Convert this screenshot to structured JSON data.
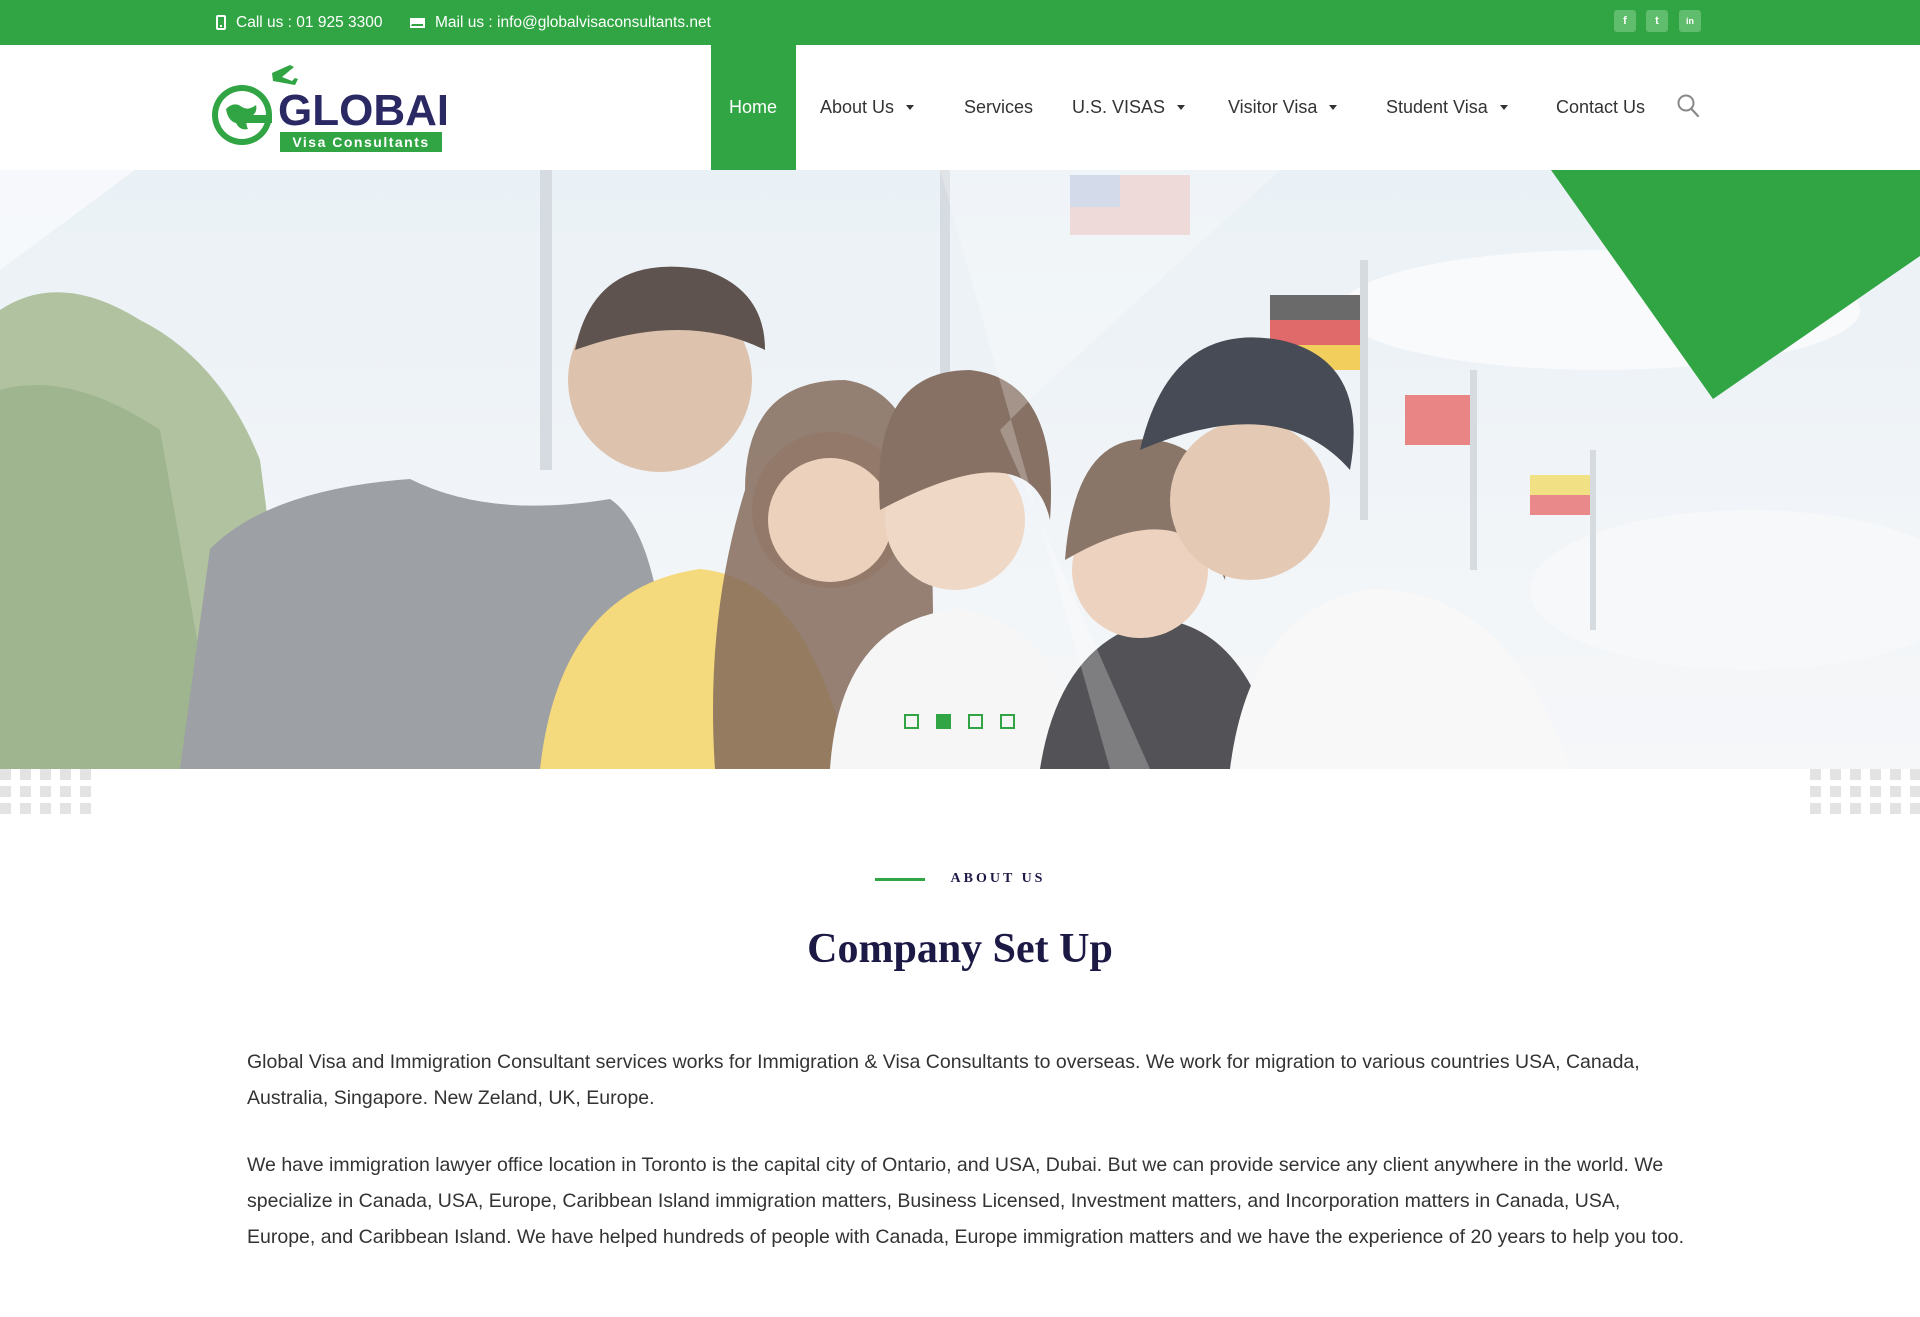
{
  "topbar": {
    "phone_text": "Call us : 01 925 3300",
    "mail_text": "Mail us : info@globalvisaconsultants.net",
    "social": [
      {
        "name": "facebook-icon",
        "glyph": "f"
      },
      {
        "name": "twitter-icon",
        "glyph": "t"
      },
      {
        "name": "linkedin-icon",
        "glyph": "in"
      }
    ]
  },
  "logo": {
    "word": "GLOBAL",
    "tagline": "Visa Consultants"
  },
  "nav": {
    "home": "Home",
    "about": "About Us",
    "services": "Services",
    "usvisas": "U.S. VISAS",
    "visitor": "Visitor Visa",
    "student": "Student Visa",
    "contact": "Contact Us"
  },
  "slider": {
    "active_slide": 2,
    "slide_count": 4
  },
  "about": {
    "tag": "ABOUT US",
    "title": "Company Set Up",
    "para1": "Global Visa and Immigration Consultant services works for Immigration & Visa Consultants to overseas. We work for migration to various countries USA, Canada, Australia, Singapore. New Zeland, UK, Europe.",
    "para2": "We have immigration lawyer office location in Toronto is the capital city of Ontario, and USA, Dubai. But we can provide service any client anywhere in the world. We specialize in Canada, USA, Europe, Caribbean Island immigration matters, Business Licensed, Investment matters, and Incorporation matters in Canada, USA, Europe, and Caribbean Island. We have helped hundreds of people with Canada, Europe immigration matters and we have the experience of 20 years to help you too."
  },
  "colors": {
    "brand_green": "#31a544",
    "navy": "#1c1a45"
  }
}
